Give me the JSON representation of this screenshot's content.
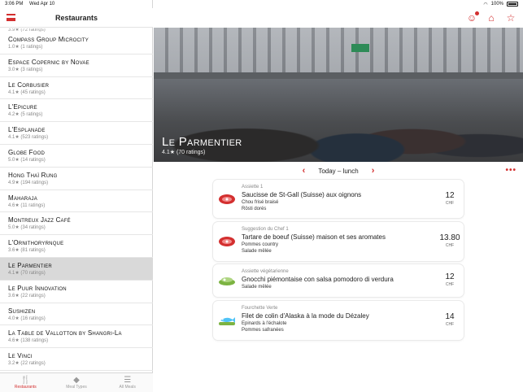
{
  "status": {
    "time": "3:06 PM",
    "date": "Wed Apr 10",
    "battery": "100%"
  },
  "sidebar": {
    "title": "Restaurants",
    "partial_rating": "3.9★ (72 ratings)",
    "items": [
      {
        "name": "Compass Group Microcity",
        "rating": "1.0★ (1 ratings)"
      },
      {
        "name": "Espace Copernic by Novae",
        "rating": "3.0★ (3 ratings)"
      },
      {
        "name": "Le Corbusier",
        "rating": "4.1★ (45 ratings)"
      },
      {
        "name": "L'Epicure",
        "rating": "4.2★ (5 ratings)"
      },
      {
        "name": "L'Esplanade",
        "rating": "4.1★ (523 ratings)"
      },
      {
        "name": "Globe Food",
        "rating": "5.0★ (14 ratings)"
      },
      {
        "name": "Hong Thaï Rung",
        "rating": "4.9★ (194 ratings)"
      },
      {
        "name": "Maharaja",
        "rating": "4.6★ (11 ratings)"
      },
      {
        "name": "Montreux Jazz Café",
        "rating": "5.0★ (34 ratings)"
      },
      {
        "name": "L'Ornithoryrnque",
        "rating": "3.6★ (81 ratings)"
      },
      {
        "name": "Le Parmentier",
        "rating": "4.1★ (70 ratings)"
      },
      {
        "name": "Le Puur Innovation",
        "rating": "3.6★ (22 ratings)"
      },
      {
        "name": "Sushizen",
        "rating": "4.0★ (16 ratings)"
      },
      {
        "name": "La Table de Vallotton by Shangri-La",
        "rating": "4.6★ (138 ratings)"
      },
      {
        "name": "Le Vinci",
        "rating": "3.2★ (22 ratings)"
      }
    ],
    "selected_index": 10
  },
  "tabbar": {
    "tabs": [
      {
        "label": "Restaurants",
        "icon": "fork-knife-icon"
      },
      {
        "label": "Meal Types",
        "icon": "tag-icon"
      },
      {
        "label": "All Meals",
        "icon": "list-icon"
      }
    ]
  },
  "main": {
    "restaurant_name": "Le Parmentier",
    "restaurant_rating": "4.1★ (70 ratings)",
    "nav_label": "Today – lunch",
    "meals": [
      {
        "category": "Assiette 1",
        "name": "Saucisse de St-Gall (Suisse) aux oignons",
        "sides": [
          "Chou frisé braisé",
          "Rösti dorés"
        ],
        "price": "12",
        "currency": "CHF",
        "icon": "meat-icon"
      },
      {
        "category": "Suggestion du Chef 1",
        "name": "Tartare de boeuf (Suisse) maison et ses aromates",
        "sides": [
          "Pommes country",
          "Salade mêlée"
        ],
        "price": "13.80",
        "currency": "CHF",
        "icon": "meat-icon"
      },
      {
        "category": "Assiette végétarienne",
        "name": "Gnocchi piémontaise con salsa pomodoro di verdura",
        "sides": [
          "Salade mêlée"
        ],
        "price": "12",
        "currency": "CHF",
        "icon": "salad-icon"
      },
      {
        "category": "Fourchette Verte",
        "name": "Filet de colin d'Alaska à la mode du Dézaley",
        "sides": [
          "Epinards à l'échalote",
          "Pommes safranées"
        ],
        "price": "14",
        "currency": "CHF",
        "icon": "fish-icon"
      }
    ]
  },
  "colors": {
    "accent": "#d32f2f",
    "selected_row": "#d9d9d9"
  }
}
